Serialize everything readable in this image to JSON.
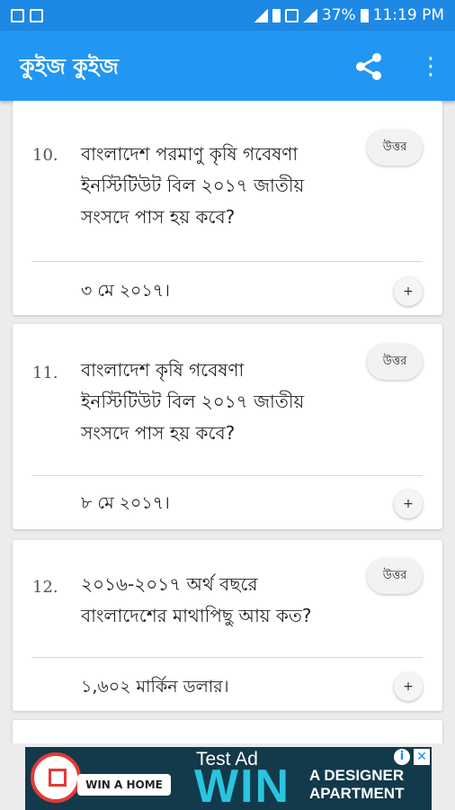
{
  "status_bar": {
    "battery": "37%",
    "time": "11:19 PM"
  },
  "app_bar": {
    "title": "কুইজ কুইজ"
  },
  "questions": [
    {
      "number": "10.",
      "lines": [
        "বাংলাদেশ পরমাণু কৃষি গবেষণা",
        "ইনস্টিটিউট বিল ২০১৭ জাতীয়",
        "সংসদে পাস হয় কবে?"
      ],
      "answer_label": "উত্তর",
      "answer": "৩ মে ২০১৭।",
      "toggle": "+"
    },
    {
      "number": "11.",
      "lines": [
        "বাংলাদেশ কৃষি গবেষণা",
        "ইনস্টিটিউট বিল ২০১৭ জাতীয়",
        "সংসদে পাস হয় কবে?"
      ],
      "answer_label": "উত্তর",
      "answer": "৮ মে ২০১৭।",
      "toggle": "+"
    },
    {
      "number": "12.",
      "lines": [
        "২০১৬-২০১৭ অর্থ বছরে",
        "বাংলাদেশের মাথাপিছু আয় কত?"
      ],
      "answer_label": "উত্তর",
      "answer": "১,৬০২ মার্কিন ডলার।",
      "toggle": "+"
    }
  ],
  "ad": {
    "test_label": "Test Ad",
    "win": "WIN",
    "win_a_home": "WIN A HOME",
    "designer_line1": "A DESIGNER",
    "designer_line2": "APARTMENT",
    "info": "i",
    "close": "✕"
  }
}
